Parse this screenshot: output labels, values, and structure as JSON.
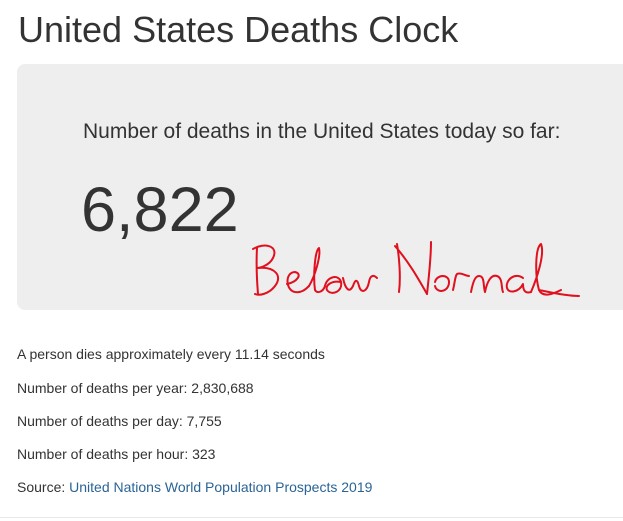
{
  "page": {
    "title": "United States Deaths Clock"
  },
  "clock": {
    "label": "Number of deaths in the United States today so far:",
    "count": "6,822",
    "handwritten_note": "Below Normal",
    "note_color": "#e0101e"
  },
  "stats": {
    "rate": "A person dies approximately every 11.14 seconds",
    "per_year": "Number of deaths per year: 2,830,688",
    "per_day": "Number of deaths per day: 7,755",
    "per_hour": "Number of deaths per hour: 323",
    "source_prefix": "Source: ",
    "source_link": "United Nations World Population Prospects 2019"
  },
  "colors": {
    "panel_background": "#eeeeee",
    "link": "#2a6496",
    "text": "#333333"
  }
}
